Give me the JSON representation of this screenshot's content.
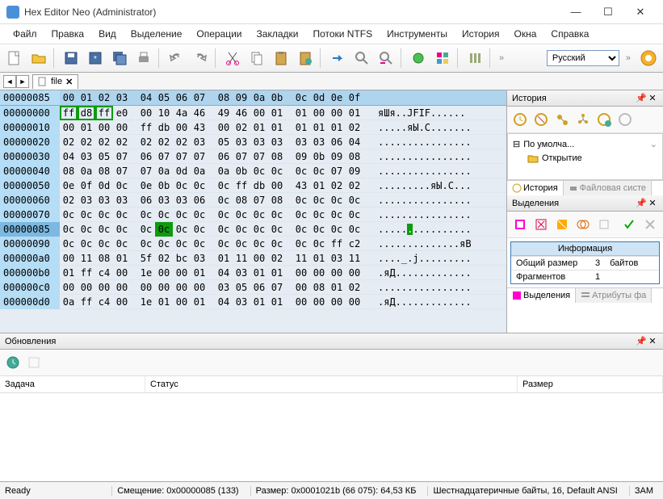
{
  "window": {
    "title": "Hex Editor Neo (Administrator)"
  },
  "menu": [
    "Файл",
    "Правка",
    "Вид",
    "Выделение",
    "Операции",
    "Закладки",
    "Потоки NTFS",
    "Инструменты",
    "История",
    "Окна",
    "Справка"
  ],
  "language": "Русский",
  "tab": {
    "name": "file"
  },
  "hex": {
    "offset_header": "00000085",
    "cols": [
      "00",
      "01",
      "02",
      "03",
      "04",
      "05",
      "06",
      "07",
      "08",
      "09",
      "0a",
      "0b",
      "0c",
      "0d",
      "0e",
      "0f"
    ],
    "rows": [
      {
        "addr": "00000000",
        "b": [
          "ff",
          "d8",
          "ff",
          "e0",
          "00",
          "10",
          "4a",
          "46",
          "49",
          "46",
          "00",
          "01",
          "01",
          "00",
          "00",
          "01"
        ],
        "a": "яШя..JFIF......"
      },
      {
        "addr": "00000010",
        "b": [
          "00",
          "01",
          "00",
          "00",
          "ff",
          "db",
          "00",
          "43",
          "00",
          "02",
          "01",
          "01",
          "01",
          "01",
          "01",
          "02"
        ],
        "a": ".....яЫ.C......."
      },
      {
        "addr": "00000020",
        "b": [
          "02",
          "02",
          "02",
          "02",
          "02",
          "02",
          "02",
          "03",
          "05",
          "03",
          "03",
          "03",
          "03",
          "03",
          "06",
          "04"
        ],
        "a": "................"
      },
      {
        "addr": "00000030",
        "b": [
          "04",
          "03",
          "05",
          "07",
          "06",
          "07",
          "07",
          "07",
          "06",
          "07",
          "07",
          "08",
          "09",
          "0b",
          "09",
          "08"
        ],
        "a": "................"
      },
      {
        "addr": "00000040",
        "b": [
          "08",
          "0a",
          "08",
          "07",
          "07",
          "0a",
          "0d",
          "0a",
          "0a",
          "0b",
          "0c",
          "0c",
          "0c",
          "0c",
          "07",
          "09"
        ],
        "a": "................"
      },
      {
        "addr": "00000050",
        "b": [
          "0e",
          "0f",
          "0d",
          "0c",
          "0e",
          "0b",
          "0c",
          "0c",
          "0c",
          "ff",
          "db",
          "00",
          "43",
          "01",
          "02",
          "02"
        ],
        "a": ".........яЫ.C..."
      },
      {
        "addr": "00000060",
        "b": [
          "02",
          "03",
          "03",
          "03",
          "06",
          "03",
          "03",
          "06",
          "0c",
          "08",
          "07",
          "08",
          "0c",
          "0c",
          "0c",
          "0c"
        ],
        "a": "................"
      },
      {
        "addr": "00000070",
        "b": [
          "0c",
          "0c",
          "0c",
          "0c",
          "0c",
          "0c",
          "0c",
          "0c",
          "0c",
          "0c",
          "0c",
          "0c",
          "0c",
          "0c",
          "0c",
          "0c"
        ],
        "a": "................"
      },
      {
        "addr": "00000085",
        "b": [
          "0c",
          "0c",
          "0c",
          "0c",
          "0c",
          "0c",
          "0c",
          "0c",
          "0c",
          "0c",
          "0c",
          "0c",
          "0c",
          "0c",
          "0c",
          "0c"
        ],
        "a": "................",
        "sel": 5
      },
      {
        "addr": "00000090",
        "b": [
          "0c",
          "0c",
          "0c",
          "0c",
          "0c",
          "0c",
          "0c",
          "0c",
          "0c",
          "0c",
          "0c",
          "0c",
          "0c",
          "0c",
          "ff",
          "c2"
        ],
        "a": "..............яВ"
      },
      {
        "addr": "000000a0",
        "b": [
          "00",
          "11",
          "08",
          "01",
          "5f",
          "02",
          "bc",
          "03",
          "01",
          "11",
          "00",
          "02",
          "11",
          "01",
          "03",
          "11"
        ],
        "a": "...._.j........."
      },
      {
        "addr": "000000b0",
        "b": [
          "01",
          "ff",
          "c4",
          "00",
          "1e",
          "00",
          "00",
          "01",
          "04",
          "03",
          "01",
          "01",
          "00",
          "00",
          "00",
          "00"
        ],
        "a": ".яД............."
      },
      {
        "addr": "000000c0",
        "b": [
          "00",
          "00",
          "00",
          "00",
          "00",
          "00",
          "00",
          "00",
          "03",
          "05",
          "06",
          "07",
          "00",
          "08",
          "01",
          "02"
        ],
        "a": "................"
      },
      {
        "addr": "000000d0",
        "b": [
          "0a",
          "ff",
          "c4",
          "00",
          "1e",
          "01",
          "00",
          "01",
          "04",
          "03",
          "01",
          "01",
          "00",
          "00",
          "00",
          "00"
        ],
        "a": ".яД............."
      }
    ],
    "mark_row": 0,
    "mark_cols": [
      0,
      1,
      2
    ]
  },
  "history": {
    "title": "История",
    "default": "По умолча...",
    "open": "Открытие",
    "tab_active": "История",
    "tab_inactive": "Файловая систе"
  },
  "selections": {
    "title": "Выделения",
    "info_header": "Информация",
    "row1_label": "Общий размер",
    "row1_val": "3",
    "row1_unit": "байтов",
    "row2_label": "Фрагментов",
    "row2_val": "1",
    "tab_active": "Выделения",
    "tab_inactive": "Атрибуты фа"
  },
  "updates": {
    "title": "Обновления",
    "cols": {
      "task": "Задача",
      "status": "Статус",
      "size": "Размер"
    }
  },
  "status": {
    "ready": "Ready",
    "offset": "Смещение: 0x00000085 (133)",
    "size": "Размер: 0x0001021b (66 075): 64,53 КБ",
    "mode": "Шестнадцатеричные байты, 16, Default ANSI",
    "ovr": "ЗАМ"
  }
}
